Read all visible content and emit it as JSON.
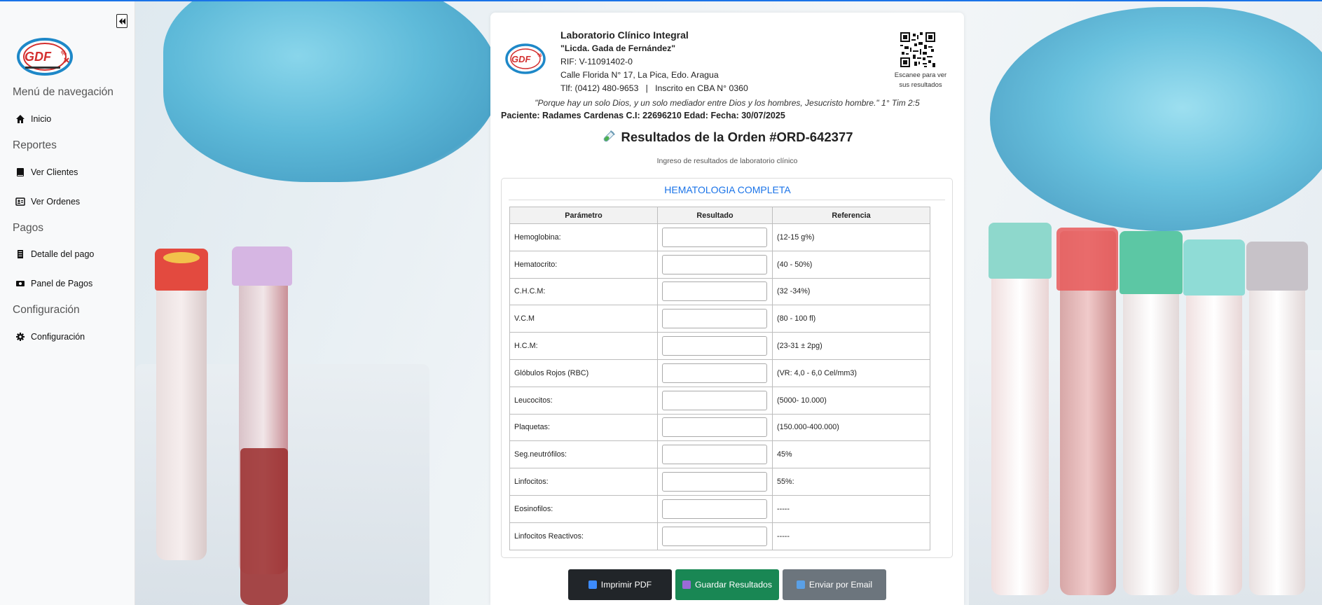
{
  "sidebar": {
    "nav_heading": "Menú de navegación",
    "items": [
      {
        "label": "Inicio",
        "icon": "home-icon"
      },
      {
        "label": "Ver Clientes",
        "icon": "book-icon"
      },
      {
        "label": "Ver Ordenes",
        "icon": "id-card-icon"
      },
      {
        "label": "Detalle del pago",
        "icon": "receipt-icon"
      },
      {
        "label": "Panel de Pagos",
        "icon": "money-icon"
      },
      {
        "label": "Configuración",
        "icon": "gear-icon"
      }
    ],
    "sections": {
      "reportes": "Reportes",
      "pagos": "Pagos",
      "configuracion": "Configuración"
    }
  },
  "header": {
    "lab_name": "Laboratorio Clínico Integral",
    "owner": "\"Licda. Gada de Fernández\"",
    "rif": "RIF: V-11091402-0",
    "address": "Calle Florida N° 17, La Pica, Edo. Aragua",
    "phone": "Tlf: (0412) 480-9653   |   Inscrito en CBA N° 0360",
    "qr_note": "Escanee para ver sus resultados",
    "verse": "\"Porque hay un solo Dios, y un solo mediador entre Dios y los hombres, Jesucristo hombre.\" 1° Tim 2:5",
    "patient": "Paciente: Radames Cardenas C.I: 22696210 Edad: Fecha: 30/07/2025"
  },
  "order": {
    "title": "Resultados de la Orden #ORD-642377",
    "subtitle": "Ingreso de resultados de laboratorio clínico"
  },
  "section": {
    "title": "HEMATOLOGIA COMPLETA",
    "columns": [
      "Parámetro",
      "Resultado",
      "Referencia"
    ],
    "rows": [
      {
        "param": "Hemoglobina:",
        "ref": "(12-15 g%)"
      },
      {
        "param": "Hematocrito:",
        "ref": "(40 - 50%)"
      },
      {
        "param": "C.H.C.M:",
        "ref": "(32 -34%)"
      },
      {
        "param": "V.C.M",
        "ref": "(80 - 100 fl)"
      },
      {
        "param": "H.C.M:",
        "ref": "(23-31 ± 2pg)"
      },
      {
        "param": "Glóbulos Rojos (RBC)",
        "ref": "(VR: 4,0 - 6,0 Cel/mm3)"
      },
      {
        "param": "Leucocitos:",
        "ref": "(5000- 10.000)"
      },
      {
        "param": "Plaquetas:",
        "ref": "(150.000-400.000)"
      },
      {
        "param": "Seg.neutrófilos:",
        "ref": "45%"
      },
      {
        "param": "Linfocitos:",
        "ref": "55%:"
      },
      {
        "param": "Eosinofilos:",
        "ref": "-----"
      },
      {
        "param": "Linfocitos Reactivos:",
        "ref": "-----"
      }
    ]
  },
  "actions": {
    "print": "Imprimir PDF",
    "save": "Guardar Resultados",
    "email": "Enviar por Email"
  },
  "colors": {
    "accent": "#1a73e8",
    "print_btn": "#212529",
    "save_btn": "#198754",
    "email_btn": "#6c757d"
  }
}
